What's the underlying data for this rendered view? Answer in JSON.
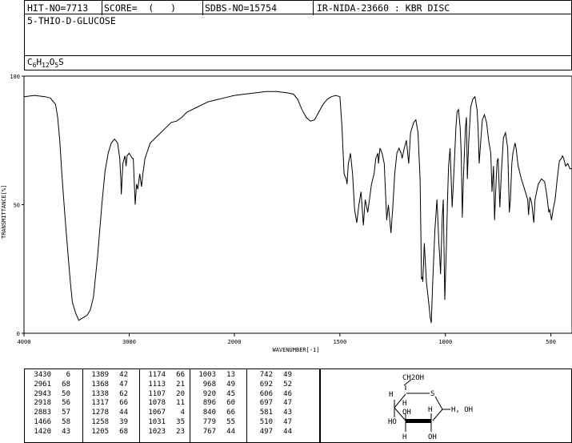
{
  "header": {
    "hit_no": "HIT-NO=7713",
    "score": "SCORE=  (   )",
    "sdbs_no": "SDBS-NO=15754",
    "method": "IR-NIDA-23660 : KBR DISC"
  },
  "compound_name": "5-THIO-D-GLUCOSE",
  "formula": {
    "c": "C",
    "c_sub": "6",
    "h": "H",
    "h_sub": "12",
    "o": "O",
    "o_sub": "5",
    "s": "S"
  },
  "chart_data": {
    "type": "line",
    "xlabel": "WAVENUMBER[-1]",
    "ylabel": "TRANSMITTANCE[%]",
    "xlim": [
      4000,
      400
    ],
    "ylim": [
      0,
      100
    ],
    "x_ticks": [
      "4000",
      "3000",
      "2000",
      "1500",
      "1000",
      "500"
    ],
    "y_ticks": [
      "0",
      "50",
      "100"
    ],
    "series": [
      {
        "points": [
          [
            4000,
            92
          ],
          [
            3900,
            92.5
          ],
          [
            3800,
            92
          ],
          [
            3750,
            91.5
          ],
          [
            3700,
            89
          ],
          [
            3680,
            84
          ],
          [
            3660,
            75
          ],
          [
            3640,
            62
          ],
          [
            3610,
            45
          ],
          [
            3580,
            30
          ],
          [
            3560,
            20
          ],
          [
            3540,
            12
          ],
          [
            3510,
            8
          ],
          [
            3480,
            5
          ],
          [
            3440,
            6
          ],
          [
            3400,
            7
          ],
          [
            3370,
            9
          ],
          [
            3340,
            14
          ],
          [
            3300,
            30
          ],
          [
            3260,
            50
          ],
          [
            3230,
            63
          ],
          [
            3200,
            70
          ],
          [
            3170,
            74
          ],
          [
            3140,
            75.5
          ],
          [
            3110,
            74
          ],
          [
            3090,
            68
          ],
          [
            3080,
            60
          ],
          [
            3075,
            54
          ],
          [
            3070,
            58
          ],
          [
            3060,
            66
          ],
          [
            3040,
            69
          ],
          [
            3030,
            65
          ],
          [
            3020,
            69
          ],
          [
            3000,
            70
          ],
          [
            2970,
            68
          ],
          [
            2961,
            68
          ],
          [
            2943,
            50
          ],
          [
            2930,
            58
          ],
          [
            2918,
            56
          ],
          [
            2900,
            62
          ],
          [
            2883,
            57
          ],
          [
            2870,
            62
          ],
          [
            2850,
            68
          ],
          [
            2800,
            74
          ],
          [
            2750,
            76
          ],
          [
            2700,
            78
          ],
          [
            2650,
            80
          ],
          [
            2600,
            82
          ],
          [
            2550,
            82.5
          ],
          [
            2500,
            84
          ],
          [
            2450,
            86
          ],
          [
            2400,
            87
          ],
          [
            2350,
            88
          ],
          [
            2300,
            89
          ],
          [
            2250,
            90
          ],
          [
            2200,
            90.5
          ],
          [
            2150,
            91
          ],
          [
            2100,
            91.5
          ],
          [
            2050,
            92
          ],
          [
            2000,
            92.5
          ],
          [
            1950,
            93
          ],
          [
            1900,
            93.5
          ],
          [
            1850,
            94
          ],
          [
            1800,
            94
          ],
          [
            1750,
            93.5
          ],
          [
            1720,
            93
          ],
          [
            1700,
            91
          ],
          [
            1680,
            87
          ],
          [
            1660,
            84
          ],
          [
            1640,
            82.5
          ],
          [
            1620,
            83
          ],
          [
            1600,
            86
          ],
          [
            1580,
            89
          ],
          [
            1560,
            91
          ],
          [
            1540,
            92
          ],
          [
            1520,
            92.5
          ],
          [
            1500,
            92
          ],
          [
            1490,
            80
          ],
          [
            1480,
            62
          ],
          [
            1470,
            60
          ],
          [
            1466,
            58
          ],
          [
            1460,
            66
          ],
          [
            1450,
            70
          ],
          [
            1440,
            62
          ],
          [
            1430,
            48
          ],
          [
            1420,
            43
          ],
          [
            1410,
            50
          ],
          [
            1400,
            55
          ],
          [
            1389,
            42
          ],
          [
            1380,
            52
          ],
          [
            1368,
            47
          ],
          [
            1350,
            58
          ],
          [
            1338,
            62
          ],
          [
            1330,
            68
          ],
          [
            1320,
            70
          ],
          [
            1317,
            66
          ],
          [
            1310,
            72
          ],
          [
            1300,
            70
          ],
          [
            1290,
            66
          ],
          [
            1278,
            44
          ],
          [
            1270,
            50
          ],
          [
            1258,
            39
          ],
          [
            1250,
            48
          ],
          [
            1240,
            62
          ],
          [
            1230,
            70
          ],
          [
            1220,
            72
          ],
          [
            1210,
            70
          ],
          [
            1205,
            68
          ],
          [
            1195,
            72
          ],
          [
            1185,
            75
          ],
          [
            1174,
            66
          ],
          [
            1165,
            78
          ],
          [
            1150,
            82
          ],
          [
            1140,
            83
          ],
          [
            1130,
            78
          ],
          [
            1120,
            60
          ],
          [
            1113,
            21
          ],
          [
            1108,
            22
          ],
          [
            1107,
            20
          ],
          [
            1100,
            35
          ],
          [
            1090,
            20
          ],
          [
            1078,
            11
          ],
          [
            1072,
            6
          ],
          [
            1067,
            4
          ],
          [
            1060,
            20
          ],
          [
            1050,
            40
          ],
          [
            1040,
            52
          ],
          [
            1031,
            35
          ],
          [
            1027,
            30
          ],
          [
            1023,
            23
          ],
          [
            1015,
            45
          ],
          [
            1010,
            52
          ],
          [
            1003,
            13
          ],
          [
            995,
            35
          ],
          [
            990,
            52
          ],
          [
            985,
            65
          ],
          [
            978,
            72
          ],
          [
            968,
            49
          ],
          [
            960,
            62
          ],
          [
            950,
            80
          ],
          [
            945,
            86
          ],
          [
            938,
            87
          ],
          [
            930,
            80
          ],
          [
            925,
            70
          ],
          [
            920,
            45
          ],
          [
            915,
            60
          ],
          [
            905,
            80
          ],
          [
            900,
            84
          ],
          [
            896,
            60
          ],
          [
            890,
            74
          ],
          [
            880,
            88
          ],
          [
            870,
            91
          ],
          [
            860,
            92
          ],
          [
            850,
            87
          ],
          [
            845,
            80
          ],
          [
            840,
            66
          ],
          [
            835,
            72
          ],
          [
            825,
            83
          ],
          [
            815,
            85
          ],
          [
            805,
            82
          ],
          [
            795,
            75
          ],
          [
            785,
            70
          ],
          [
            779,
            55
          ],
          [
            772,
            65
          ],
          [
            767,
            44
          ],
          [
            760,
            58
          ],
          [
            755,
            67
          ],
          [
            750,
            68
          ],
          [
            742,
            49
          ],
          [
            735,
            62
          ],
          [
            725,
            76
          ],
          [
            715,
            78
          ],
          [
            705,
            72
          ],
          [
            697,
            47
          ],
          [
            692,
            52
          ],
          [
            685,
            66
          ],
          [
            680,
            70
          ],
          [
            675,
            72
          ],
          [
            670,
            74
          ],
          [
            665,
            72
          ],
          [
            655,
            65
          ],
          [
            640,
            60
          ],
          [
            625,
            56
          ],
          [
            610,
            52
          ],
          [
            606,
            46
          ],
          [
            600,
            53
          ],
          [
            595,
            52
          ],
          [
            590,
            50
          ],
          [
            585,
            46
          ],
          [
            581,
            43
          ],
          [
            575,
            52
          ],
          [
            560,
            58
          ],
          [
            545,
            60
          ],
          [
            530,
            59
          ],
          [
            520,
            54
          ],
          [
            510,
            47
          ],
          [
            505,
            48
          ],
          [
            497,
            44
          ],
          [
            490,
            48
          ],
          [
            480,
            52
          ],
          [
            470,
            60
          ],
          [
            460,
            67
          ],
          [
            450,
            68
          ],
          [
            445,
            69
          ],
          [
            440,
            68
          ],
          [
            430,
            65
          ],
          [
            420,
            66
          ],
          [
            410,
            64
          ],
          [
            400,
            64
          ]
        ]
      }
    ]
  },
  "peak_table": [
    [
      [
        "3430",
        "6"
      ],
      [
        "2961",
        "68"
      ],
      [
        "2943",
        "50"
      ],
      [
        "2918",
        "56"
      ],
      [
        "2883",
        "57"
      ],
      [
        "1466",
        "58"
      ],
      [
        "1420",
        "43"
      ]
    ],
    [
      [
        "1389",
        "42"
      ],
      [
        "1368",
        "47"
      ],
      [
        "1338",
        "62"
      ],
      [
        "1317",
        "66"
      ],
      [
        "1278",
        "44"
      ],
      [
        "1258",
        "39"
      ],
      [
        "1205",
        "68"
      ]
    ],
    [
      [
        "1174",
        "66"
      ],
      [
        "1113",
        "21"
      ],
      [
        "1107",
        "20"
      ],
      [
        "1078",
        "11"
      ],
      [
        "1067",
        "4"
      ],
      [
        "1031",
        "35"
      ],
      [
        "1023",
        "23"
      ]
    ],
    [
      [
        "1003",
        "13"
      ],
      [
        "968",
        "49"
      ],
      [
        "920",
        "45"
      ],
      [
        "896",
        "60"
      ],
      [
        "840",
        "66"
      ],
      [
        "779",
        "55"
      ],
      [
        "767",
        "44"
      ]
    ],
    [
      [
        "742",
        "49"
      ],
      [
        "692",
        "52"
      ],
      [
        "606",
        "46"
      ],
      [
        "697",
        "47"
      ],
      [
        "581",
        "43"
      ],
      [
        "510",
        "47"
      ],
      [
        "497",
        "44"
      ]
    ]
  ],
  "structure": {
    "labels": {
      "ch2oh": "CH2OH",
      "s": "S",
      "h_left": "H",
      "h_c5": "H",
      "h_c4": "H",
      "oh_c3": "OH",
      "ho_c4": "HO",
      "h_c2": "H",
      "oh_c2": "OH",
      "oh_c1": "H, OH",
      "h_bottom_c3": "H",
      "oh_bottom": "OH"
    }
  }
}
